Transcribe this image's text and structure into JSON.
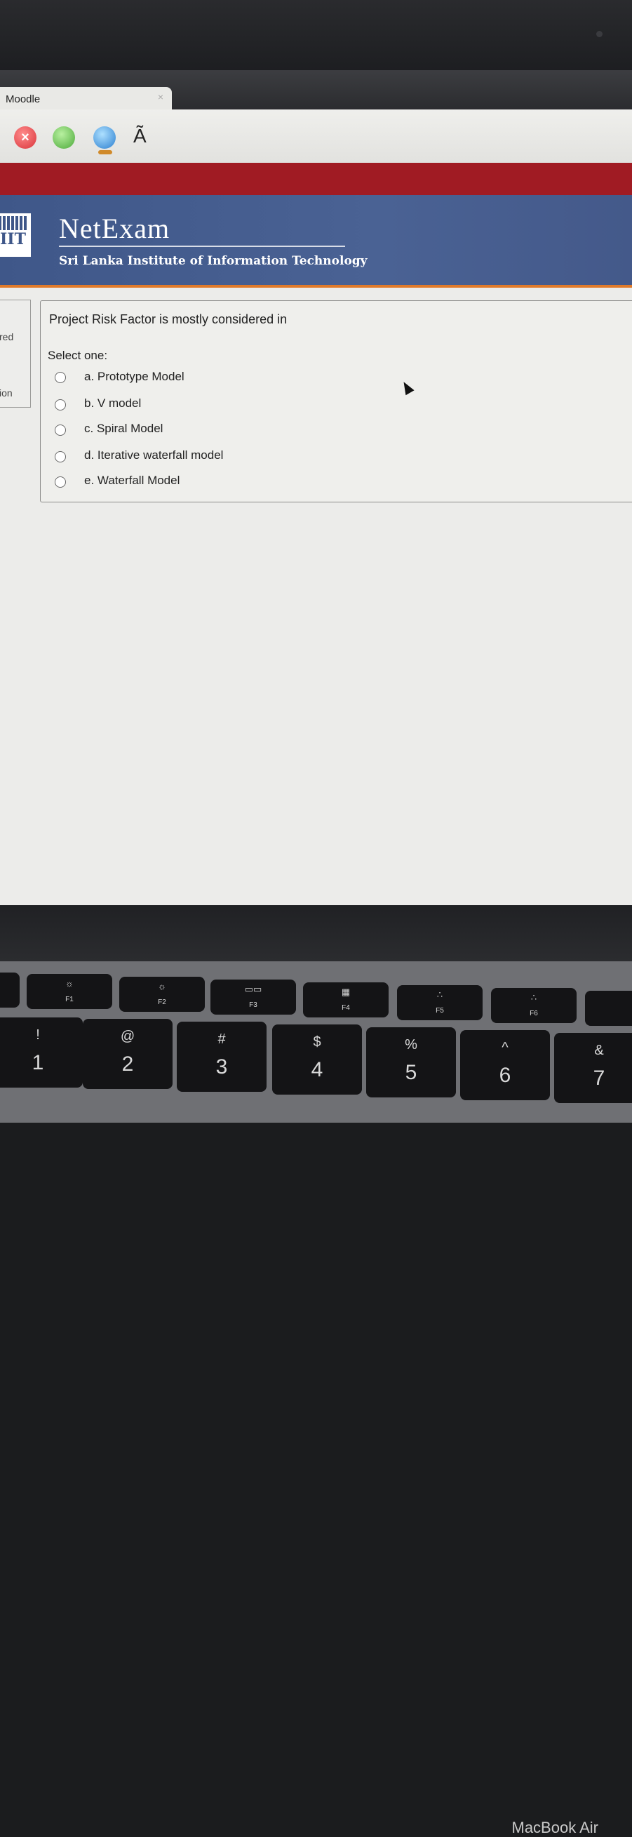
{
  "browser": {
    "tab_title": "Moodle",
    "tab_close": "×",
    "font_icon_glyph": "Ã"
  },
  "header": {
    "brand": "NetExam",
    "subtitle": "Sri Lanka Institute of Information Technology",
    "logo_text": "IIT"
  },
  "sidebar": {
    "fragment_1": "red",
    "fragment_2": "ion"
  },
  "question": {
    "text": "Project Risk Factor is mostly considered in",
    "prompt": "Select one:",
    "options": [
      {
        "label": "a.  Prototype Model",
        "selected": false
      },
      {
        "label": "b. V model",
        "selected": false
      },
      {
        "label": "c. Spiral Model",
        "selected": false
      },
      {
        "label": "d.  Iterative waterfall model",
        "selected": false
      },
      {
        "label": "e.  Waterfall Model",
        "selected": false
      }
    ]
  },
  "device": {
    "label": "MacBook Air",
    "fkeys": [
      "F1",
      "F2",
      "F3",
      "F4",
      "F5",
      "F6"
    ],
    "number_keys": [
      {
        "top": "!",
        "bottom": "1"
      },
      {
        "top": "@",
        "bottom": "2"
      },
      {
        "top": "#",
        "bottom": "3"
      },
      {
        "top": "$",
        "bottom": "4"
      },
      {
        "top": "%",
        "bottom": "5"
      },
      {
        "top": "^",
        "bottom": "6"
      },
      {
        "top": "&",
        "bottom": "7"
      }
    ]
  },
  "colors": {
    "header_red": "#a01b23",
    "header_blue": "#4a6294",
    "accent_orange": "#e07a2a"
  }
}
